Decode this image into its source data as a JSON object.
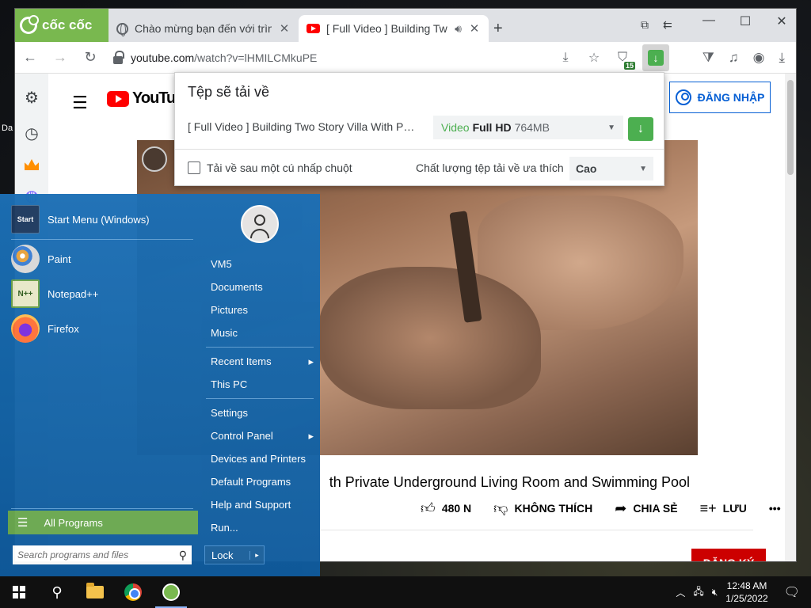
{
  "desktop": {
    "icon_label": "Da"
  },
  "browser": {
    "brand": "cốc cốc",
    "tabs": [
      {
        "title": "Chào mừng bạn đến với trình",
        "active": false
      },
      {
        "title": "[ Full Video ] Building Tw",
        "active": true
      }
    ],
    "url_host": "youtube.com",
    "url_path": "/watch?v=lHMILCMkuPE",
    "extension_badge": "15",
    "colors": {
      "brand": "#79b84f",
      "download_green": "#4caf50"
    }
  },
  "download_popup": {
    "title": "Tệp sẽ tải về",
    "file_name": "[ Full Video ] Building Two Story Villa With Pri...",
    "quality_type": "Video",
    "quality_res": "Full HD",
    "quality_size": "764MB",
    "one_click_label": "Tải về sau một cú nhấp chuột",
    "pref_label": "Chất lượng tệp tải về ưa thích",
    "pref_value": "Cao"
  },
  "youtube": {
    "logo_text": "YouTube",
    "sign_in": "ĐĂNG NHẬP",
    "video_title": "th Private Underground Living Room and Swimming Pool",
    "likes": "480 N",
    "dislike": "KHÔNG THÍCH",
    "share": "CHIA SẺ",
    "save": "LƯU",
    "more": "•••",
    "subscribe": "ĐĂNG KÝ"
  },
  "start_menu": {
    "pinned": [
      {
        "label": "Start Menu (Windows)",
        "icon": "start-menu-app-icon",
        "icon_text": "Start"
      },
      {
        "label": "Paint",
        "icon": "paint-icon"
      },
      {
        "label": "Notepad++",
        "icon": "notepad-plus-plus-icon",
        "icon_text": "N++"
      },
      {
        "label": "Firefox",
        "icon": "firefox-icon"
      }
    ],
    "all_programs": "All Programs",
    "search_placeholder": "Search programs and files",
    "right_links": [
      {
        "label": "VM5"
      },
      {
        "label": "Documents"
      },
      {
        "label": "Pictures"
      },
      {
        "label": "Music"
      },
      {
        "label": "Recent Items",
        "arrow": "▸"
      },
      {
        "label": "This PC"
      },
      {
        "label": "Settings"
      },
      {
        "label": "Control Panel",
        "arrow": "▸"
      },
      {
        "label": "Devices and Printers"
      },
      {
        "label": "Default Programs"
      },
      {
        "label": "Help and Support"
      },
      {
        "label": "Run..."
      }
    ],
    "lock": "Lock",
    "lock_arrow": "▸"
  },
  "taskbar": {
    "time": "12:48 AM",
    "date": "1/25/2022"
  }
}
